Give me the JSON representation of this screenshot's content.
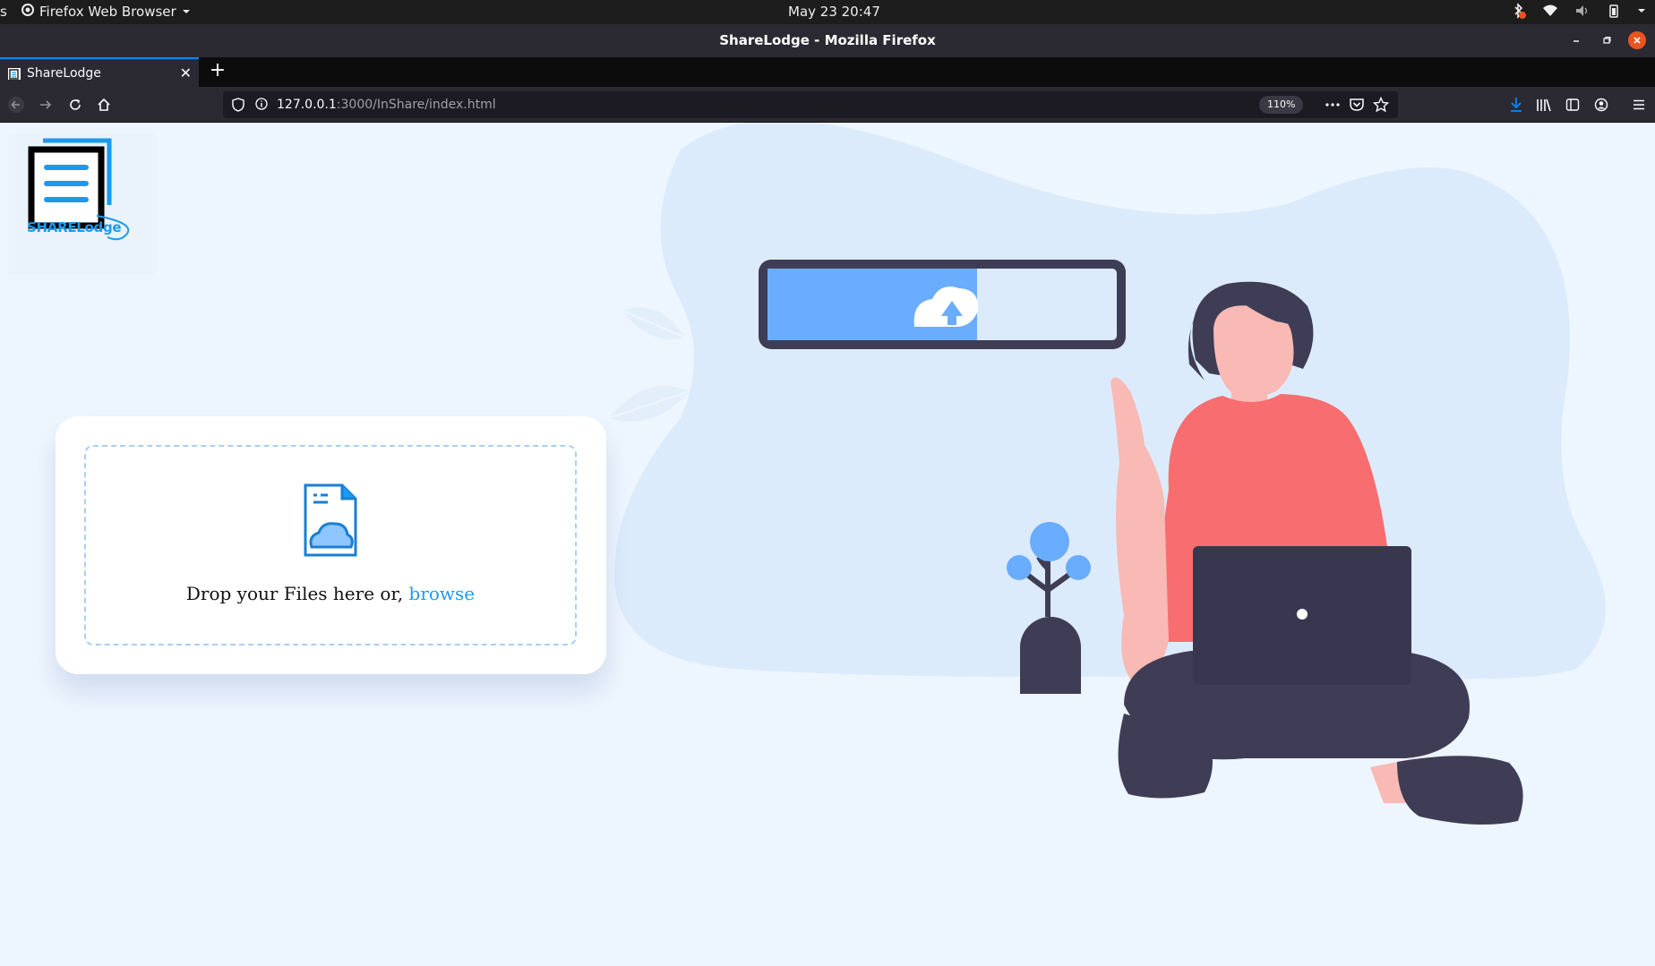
{
  "system_bar": {
    "activities": "s",
    "app_name": "Firefox Web Browser",
    "datetime": "May 23  20:47"
  },
  "window": {
    "title": "ShareLodge - Mozilla Firefox"
  },
  "tabs": [
    {
      "label": "ShareLodge",
      "active": true
    }
  ],
  "navbar": {
    "url_host": "127.0.0.1",
    "url_path": ":3000/InShare/index.html",
    "zoom": "110%"
  },
  "page": {
    "logo_text": "SHARELodge",
    "upload": {
      "drop_text": "Drop your Files here or, ",
      "browse_label": "browse"
    },
    "progress_fraction": 0.6
  },
  "colors": {
    "accent": "#1a9af0",
    "progress_fill": "#6aacfd",
    "dark": "#3f3d56",
    "shirt": "#f86d70",
    "skin": "#f9b9b5",
    "blob": "#dcebfc"
  }
}
